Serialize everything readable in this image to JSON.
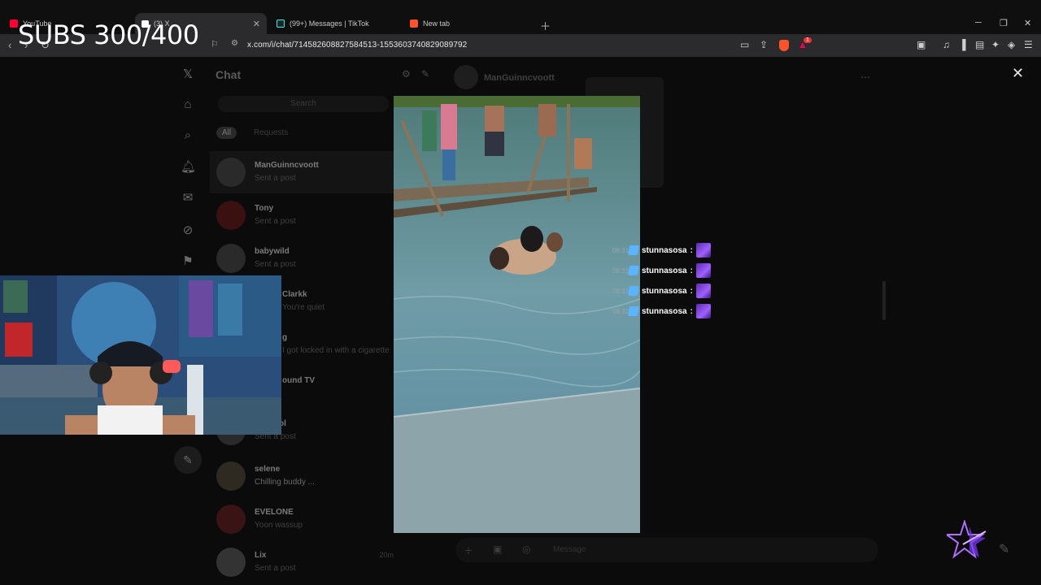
{
  "overlay": {
    "subs_counter": "SUBS 300/400"
  },
  "browser": {
    "tabs": [
      {
        "label": "YouTube",
        "active": false
      },
      {
        "label": "(3) X",
        "active": true
      },
      {
        "label": "(99+) Messages | TikTok",
        "active": false
      },
      {
        "label": "New tab",
        "active": false
      }
    ],
    "url": "x.com/i/chat/7145826088275845 13-1553603740829089792",
    "url_display": "x.com/i/chat/714582608827584513-1553603740829089792",
    "notification_badge": "1"
  },
  "x_app": {
    "chat_title": "Chat",
    "search_placeholder": "Search",
    "filters": {
      "all": "All",
      "requests": "Requests"
    },
    "conversations": [
      {
        "name": "ManGuinncvoott",
        "preview": "Sent a post"
      },
      {
        "name": "Tony",
        "preview": "Sent a post"
      },
      {
        "name": "babywild",
        "preview": "Sent a post"
      },
      {
        "name": "Clarkk",
        "preview": "You're quiet"
      },
      {
        "name": "g",
        "preview": "I got locked in with a cigarette"
      },
      {
        "name": "ound TV",
        "preview": ""
      },
      {
        "name": "ol",
        "preview": "Sent a post"
      },
      {
        "name": "selene",
        "preview": "Chilling buddy ..."
      },
      {
        "name": "EVELONE",
        "preview": "Yoon wassup"
      },
      {
        "name": "Lix",
        "preview": "Sent a post",
        "time": "20m"
      }
    ],
    "dm_header_name": "ManGuinncvoott",
    "composer_placeholder": "Message"
  },
  "stream_chat": [
    {
      "time": "08:31",
      "user": "stunnasosa",
      "sep": ":"
    },
    {
      "time": "08:31",
      "user": "stunnasosa",
      "sep": ":"
    },
    {
      "time": "08:31",
      "user": "stunnasosa",
      "sep": ":"
    },
    {
      "time": "08:31",
      "user": "stunnasosa",
      "sep": ":"
    }
  ],
  "colors": {
    "chat_user_icon": "#5ab4ff",
    "emote": "#7a3cff",
    "brand_logo": "#b070ff"
  }
}
